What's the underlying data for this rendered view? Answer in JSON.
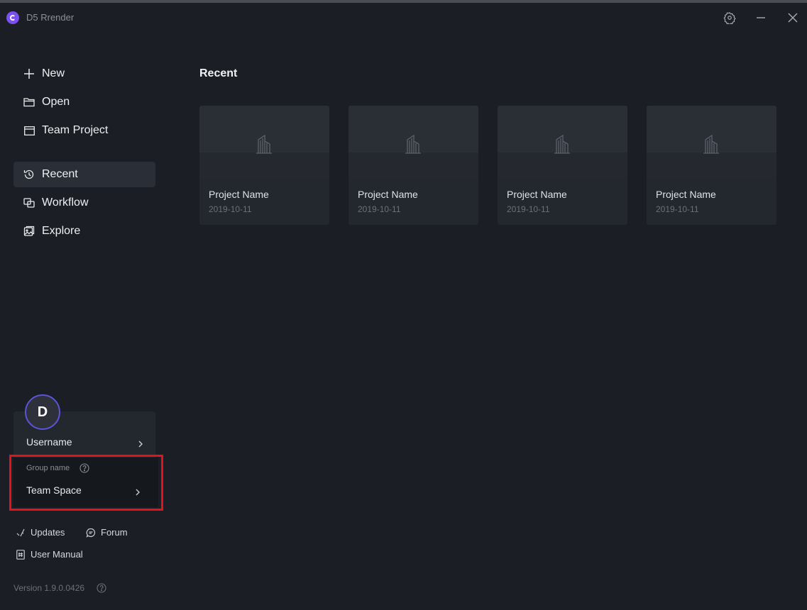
{
  "window": {
    "title": "D5 Rrender",
    "logo_icon": "d5-logo-icon",
    "controls": [
      "gear-icon",
      "minimize-icon",
      "close-icon"
    ]
  },
  "sidebar": {
    "actions": [
      {
        "label": "New",
        "icon": "plus-icon"
      },
      {
        "label": "Open",
        "icon": "folder-icon"
      },
      {
        "label": "Team Project",
        "icon": "window-icon"
      }
    ],
    "nav": [
      {
        "label": "Recent",
        "icon": "history-icon",
        "active": true
      },
      {
        "label": "Workflow",
        "icon": "workflow-icon",
        "active": false
      },
      {
        "label": "Explore",
        "icon": "explore-icon",
        "active": false
      }
    ]
  },
  "main": {
    "section_title": "Recent",
    "projects": [
      {
        "name": "Project Name",
        "date": "2019-10-11"
      },
      {
        "name": "Project Name",
        "date": "2019-10-11"
      },
      {
        "name": "Project Name",
        "date": "2019-10-11"
      },
      {
        "name": "Project Name",
        "date": "2019-10-11"
      }
    ]
  },
  "user": {
    "avatar_letter": "D",
    "username": "Username",
    "group_name": "Group name",
    "team_space": "Team Space"
  },
  "footer": {
    "updates": "Updates",
    "forum": "Forum",
    "user_manual": "User Manual",
    "version": "Version 1.9.0.0426"
  },
  "colors": {
    "background": "#1b1f25",
    "card": "#23272e",
    "active_nav": "#2a2f37",
    "accent_logo": "#7b4ff2",
    "avatar_ring": "#5a55d6",
    "highlight": "#e8101b"
  }
}
